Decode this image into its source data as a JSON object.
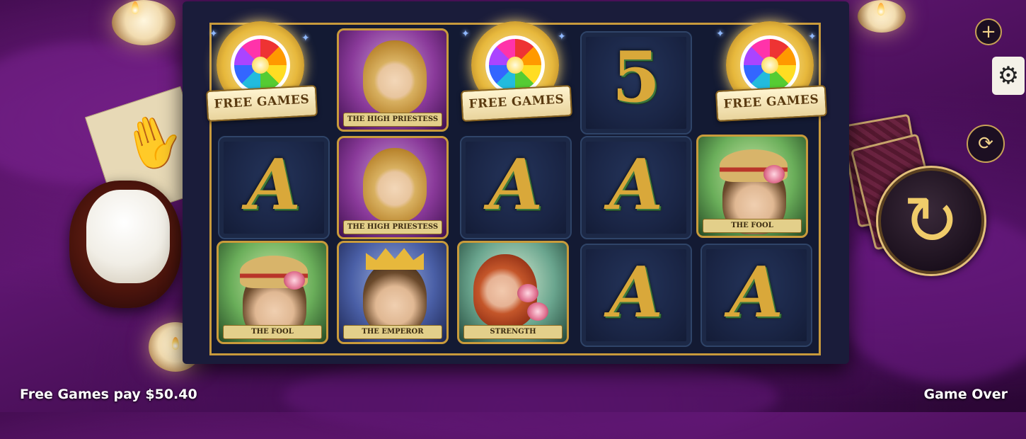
{
  "reels": [
    [
      {
        "type": "free-games",
        "label": "FREE GAMES"
      },
      {
        "type": "letter",
        "label": "A"
      },
      {
        "type": "card",
        "label": "THE FOOL"
      }
    ],
    [
      {
        "type": "card",
        "label": "THE HIGH PRIESTESS"
      },
      {
        "type": "card",
        "label": "THE HIGH PRIESTESS"
      },
      {
        "type": "card",
        "label": "THE EMPEROR"
      }
    ],
    [
      {
        "type": "free-games",
        "label": "FREE GAMES"
      },
      {
        "type": "letter",
        "label": "A"
      },
      {
        "type": "card",
        "label": "STRENGTH"
      }
    ],
    [
      {
        "type": "letter",
        "label": "5"
      },
      {
        "type": "letter",
        "label": "A"
      },
      {
        "type": "letter",
        "label": "A"
      }
    ],
    [
      {
        "type": "free-games",
        "label": "FREE GAMES"
      },
      {
        "type": "card",
        "label": "THE FOOL"
      },
      {
        "type": "letter",
        "label": "A"
      }
    ]
  ],
  "controls": {
    "plus_symbol": "+",
    "autoplay_symbol": "⟳",
    "spin_symbol": "↻",
    "settings_symbol": "⚙"
  },
  "footer": {
    "win_message": "Free Games pay $50.40",
    "status": "Game Over"
  }
}
